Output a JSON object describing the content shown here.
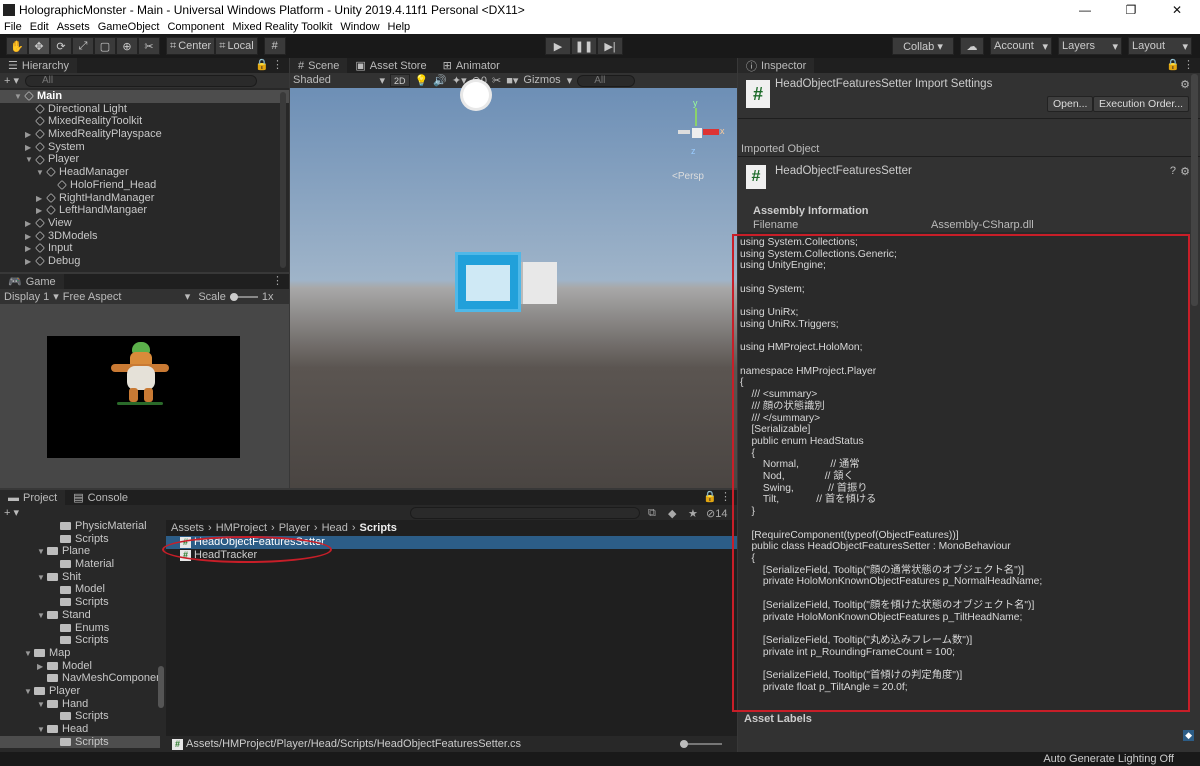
{
  "window": {
    "title": "HolographicMonster - Main - Universal Windows Platform - Unity 2019.4.11f1 Personal <DX11>"
  },
  "menu": [
    "File",
    "Edit",
    "Assets",
    "GameObject",
    "Component",
    "Mixed Reality Toolkit",
    "Window",
    "Help"
  ],
  "toolbar": {
    "center_label": "Center",
    "local_label": "Local",
    "collab_label": "Collab ▾",
    "account_label": "Account",
    "layers_label": "Layers",
    "layout_label": "Layout"
  },
  "hierarchy": {
    "tab": "Hierarchy",
    "search_placeholder": "All",
    "items": [
      {
        "label": "Main",
        "indent": 0,
        "arrow": "▼",
        "kind": "scene"
      },
      {
        "label": "Directional Light",
        "indent": 1,
        "arrow": "",
        "kind": "obj"
      },
      {
        "label": "MixedRealityToolkit",
        "indent": 1,
        "arrow": "",
        "kind": "obj"
      },
      {
        "label": "MixedRealityPlayspace",
        "indent": 1,
        "arrow": "▶",
        "kind": "obj"
      },
      {
        "label": "System",
        "indent": 1,
        "arrow": "▶",
        "kind": "obj"
      },
      {
        "label": "Player",
        "indent": 1,
        "arrow": "▼",
        "kind": "obj"
      },
      {
        "label": "HeadManager",
        "indent": 2,
        "arrow": "▼",
        "kind": "obj"
      },
      {
        "label": "HoloFriend_Head",
        "indent": 3,
        "arrow": "",
        "kind": "obj"
      },
      {
        "label": "RightHandManager",
        "indent": 2,
        "arrow": "▶",
        "kind": "obj"
      },
      {
        "label": "LeftHandMangaer",
        "indent": 2,
        "arrow": "▶",
        "kind": "obj"
      },
      {
        "label": "View",
        "indent": 1,
        "arrow": "▶",
        "kind": "obj"
      },
      {
        "label": "3DModels",
        "indent": 1,
        "arrow": "▶",
        "kind": "obj"
      },
      {
        "label": "Input",
        "indent": 1,
        "arrow": "▶",
        "kind": "obj"
      },
      {
        "label": "Debug",
        "indent": 1,
        "arrow": "▶",
        "kind": "obj"
      }
    ]
  },
  "game": {
    "tab": "Game",
    "display": "Display 1",
    "aspect": "Free Aspect",
    "scale_label": "Scale",
    "scale_value": "1x"
  },
  "scene": {
    "tabs": [
      "Scene",
      "Asset Store",
      "Animator"
    ],
    "shading": "Shaded",
    "mode2d": "2D",
    "gizmos": "Gizmos",
    "search_placeholder": "All",
    "persp": "Persp",
    "hidden_count": "0",
    "axis_y": "y",
    "axis_x": "x",
    "axis_z": "z"
  },
  "project": {
    "tabs": [
      "Project",
      "Console"
    ],
    "hidden_count": "14",
    "tree": [
      {
        "label": "PhysicMaterial",
        "indent": 2,
        "arrow": ""
      },
      {
        "label": "Scripts",
        "indent": 2,
        "arrow": ""
      },
      {
        "label": "Plane",
        "indent": 1,
        "arrow": "▼"
      },
      {
        "label": "Material",
        "indent": 2,
        "arrow": ""
      },
      {
        "label": "Shit",
        "indent": 1,
        "arrow": "▼"
      },
      {
        "label": "Model",
        "indent": 2,
        "arrow": ""
      },
      {
        "label": "Scripts",
        "indent": 2,
        "arrow": ""
      },
      {
        "label": "Stand",
        "indent": 1,
        "arrow": "▼"
      },
      {
        "label": "Enums",
        "indent": 2,
        "arrow": ""
      },
      {
        "label": "Scripts",
        "indent": 2,
        "arrow": ""
      },
      {
        "label": "Map",
        "indent": 0,
        "arrow": "▼"
      },
      {
        "label": "Model",
        "indent": 1,
        "arrow": "▶"
      },
      {
        "label": "NavMeshComponen",
        "indent": 1,
        "arrow": ""
      },
      {
        "label": "Player",
        "indent": 0,
        "arrow": "▼"
      },
      {
        "label": "Hand",
        "indent": 1,
        "arrow": "▼"
      },
      {
        "label": "Scripts",
        "indent": 2,
        "arrow": ""
      },
      {
        "label": "Head",
        "indent": 1,
        "arrow": "▼"
      },
      {
        "label": "Scripts",
        "indent": 2,
        "arrow": "",
        "selected": true
      }
    ],
    "breadcrumb": [
      "Assets",
      "HMProject",
      "Player",
      "Head",
      "Scripts"
    ],
    "files": [
      {
        "label": "HeadObjectFeaturesSetter",
        "selected": true
      },
      {
        "label": "HeadTracker",
        "selected": false
      }
    ],
    "status_path": "Assets/HMProject/Player/Head/Scripts/HeadObjectFeaturesSetter.cs"
  },
  "inspector": {
    "tab": "Inspector",
    "title": "HeadObjectFeaturesSetter Import Settings",
    "open_button": "Open...",
    "exec_order_button": "Execution Order...",
    "imported_object_label": "Imported Object",
    "object_name": "HeadObjectFeaturesSetter",
    "assembly_header": "Assembly Information",
    "filename_label": "Filename",
    "filename_value": "Assembly-CSharp.dll",
    "code": "using System.Collections;\nusing System.Collections.Generic;\nusing UnityEngine;\n\nusing System;\n\nusing UniRx;\nusing UniRx.Triggers;\n\nusing HMProject.HoloMon;\n\nnamespace HMProject.Player\n{\n    /// <summary>\n    /// 顔の状態識別\n    /// </summary>\n    [Serializable]\n    public enum HeadStatus\n    {\n        Normal,           // 通常\n        Nod,              // 頷く\n        Swing,            // 首振り\n        Tilt,             // 首を傾ける\n    }\n\n    [RequireComponent(typeof(ObjectFeatures))]\n    public class HeadObjectFeaturesSetter : MonoBehaviour\n    {\n        [SerializeField, Tooltip(\"顔の通常状態のオブジェクト名\")]\n        private HoloMonKnownObjectFeatures p_NormalHeadName;\n\n        [SerializeField, Tooltip(\"顔を傾けた状態のオブジェクト名\")]\n        private HoloMonKnownObjectFeatures p_TiltHeadName;\n\n        [SerializeField, Tooltip(\"丸め込みフレーム数\")]\n        private int p_RoundingFrameCount = 100;\n\n        [SerializeField, Tooltip(\"首傾けの判定角度\")]\n        private float p_TiltAngle = 20.0f;",
    "asset_labels": "Asset Labels"
  },
  "statusbar": {
    "text": "Auto Generate Lighting Off"
  },
  "colors": {
    "highlight_red": "#c81e28",
    "selection_blue": "#2c5d87"
  }
}
